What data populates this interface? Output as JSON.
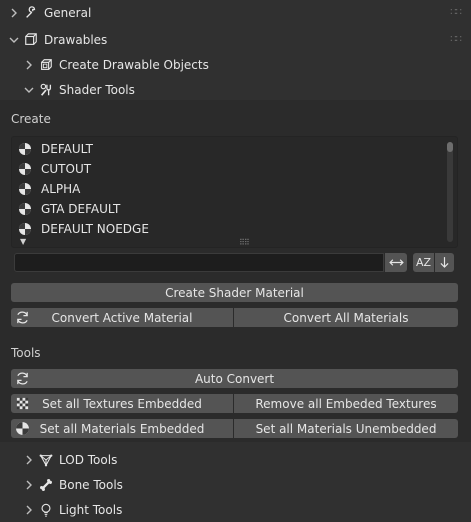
{
  "panels": {
    "general": "General",
    "drawables": "Drawables",
    "create_drawable_objects": "Create Drawable Objects",
    "shader_tools": "Shader Tools",
    "lod_tools": "LOD Tools",
    "bone_tools": "Bone Tools",
    "light_tools": "Light Tools"
  },
  "create_section": {
    "label": "Create",
    "shader_list": [
      "DEFAULT",
      "CUTOUT",
      "ALPHA",
      "GTA DEFAULT",
      "DEFAULT NOEDGE"
    ],
    "filter_value": "",
    "sort_label": "AZ",
    "create_button": "Create Shader Material",
    "convert_active_button": "Convert Active Material",
    "convert_all_button": "Convert All Materials"
  },
  "tools_section": {
    "label": "Tools",
    "auto_convert_button": "Auto Convert",
    "set_textures_embedded_button": "Set all Textures Embedded",
    "remove_embedded_textures_button": "Remove all Embeded Textures",
    "set_materials_embedded_button": "Set all Materials Embedded",
    "set_materials_unembedded_button": "Set all Materials Unembedded"
  },
  "icons": {
    "general": "wrench-icon",
    "drawables": "cube-icon",
    "create_drawable_objects": "cube-stack-icon",
    "shader_tools": "tools-icon",
    "lod_tools": "mesh-icon",
    "bone_tools": "bone-icon",
    "light_tools": "bulb-icon",
    "material": "material-sphere-icon",
    "refresh": "refresh-icon",
    "checker": "checker-icon"
  },
  "colors": {
    "background": "#303030",
    "subpanel": "#2b2b2b",
    "button": "#545454",
    "list": "#282828"
  }
}
